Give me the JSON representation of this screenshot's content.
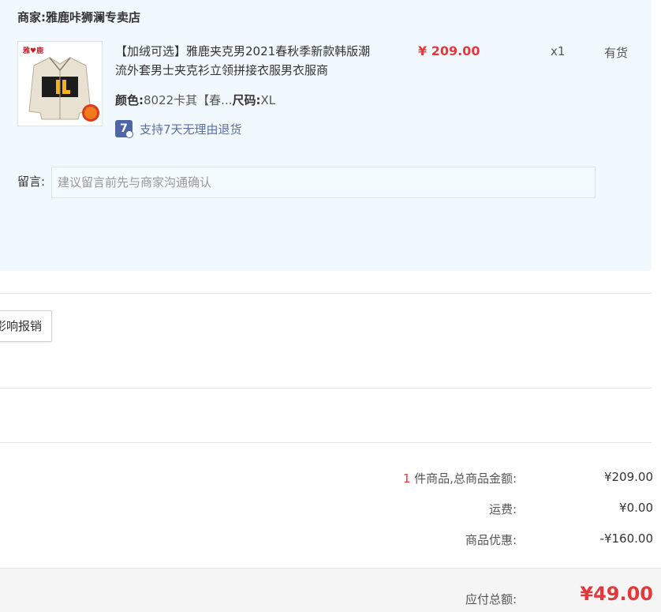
{
  "shop": {
    "merchant_label": "商家:雅鹿咔狮澜专卖店"
  },
  "item": {
    "image_name": "jacket-product-image",
    "title": "【加绒可选】雅鹿夹克男2021春秋季新款韩版潮流外套男士夹克衫立领拼接衣服男衣服商",
    "price": "¥ 209.00",
    "quantity": "x1",
    "stock": "有货",
    "color_label": "颜色:",
    "color_value": "8022卡其【春...",
    "size_label": "尺码:",
    "size_value": "XL",
    "returns_badge": "7",
    "returns_text": "支持7天无理由退货",
    "return_icon": "seven-day-return-icon"
  },
  "message": {
    "label": "留言:",
    "placeholder": "建议留言前先与商家沟通确认"
  },
  "invoice": {
    "button_label": "影响报销"
  },
  "summary": {
    "count": "1",
    "goods_label": "件商品,总商品金额:",
    "goods_value": "¥209.00",
    "shipping_label": "运费:",
    "shipping_value": "¥0.00",
    "discount_label": "商品优惠:",
    "discount_value": "-¥160.00",
    "total_label": "应付总额:",
    "total_value": "¥49.00"
  },
  "colors": {
    "panel_bg": "#f2f9fe",
    "price_red": "#e4393c",
    "return_blue": "#4e66a6"
  }
}
